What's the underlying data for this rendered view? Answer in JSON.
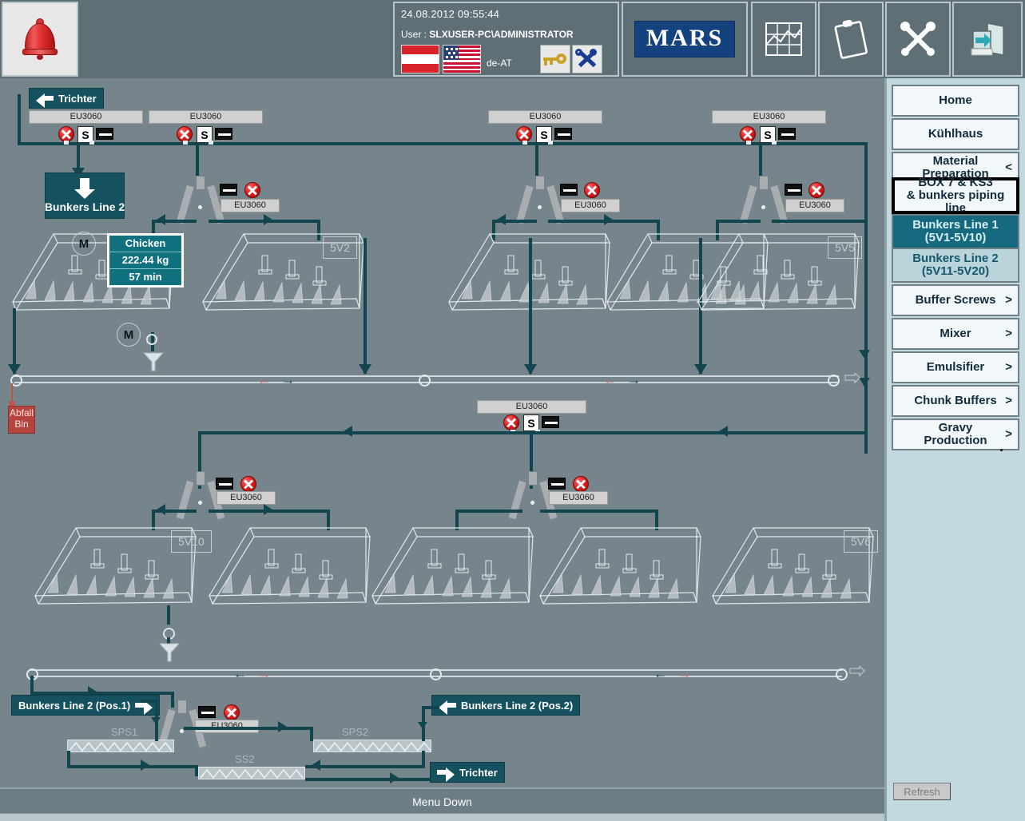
{
  "header": {
    "alarm_icon": "alarm-bell-icon",
    "datetime": "24.08.2012 09:55:44",
    "user_label": "User :",
    "user_name": "SLXUSER-PC\\ADMINISTRATOR",
    "flag_at": "austria-flag-icon",
    "flag_us": "usa-flag-icon",
    "locale": "de-AT",
    "key_gold": "gold-key-icon",
    "key_blue": "blue-crossed-keys-icon",
    "brand": "MARS",
    "trend_icon": "trend-chart-icon",
    "report_icon": "clipboard-report-icon",
    "tools_icon": "hammer-wrench-icon",
    "exit_icon": "exit-door-icon"
  },
  "sidebar": {
    "items": [
      {
        "label": "Home",
        "chev": "",
        "state": "normal"
      },
      {
        "label": "Kühlhaus",
        "chev": "",
        "state": "normal"
      },
      {
        "label": "Material\nPreparation",
        "chev": "<",
        "state": "normal"
      },
      {
        "label": "BOX 7 & KS3\n& bunkers piping line",
        "chev": "",
        "state": "outlined"
      },
      {
        "label": "Bunkers Line 1\n(5V1-5V10)",
        "chev": "",
        "state": "active"
      },
      {
        "label": "Bunkers Line 2\n(5V11-5V20)",
        "chev": "",
        "state": "selected"
      },
      {
        "label": "Buffer Screws",
        "chev": ">",
        "state": "normal"
      },
      {
        "label": "Mixer",
        "chev": ">",
        "state": "normal"
      },
      {
        "label": "Emulsifier",
        "chev": ">",
        "state": "normal"
      },
      {
        "label": "Chunk Buffers",
        "chev": ">",
        "state": "normal"
      },
      {
        "label": "Gravy\nProduction",
        "chev": ">",
        "state": "normal"
      }
    ],
    "refresh_label": "Refresh"
  },
  "page": {
    "title": "Bunkers Line 1 (5V1 - 5V10)",
    "status_text": "Menu Down"
  },
  "navplates": {
    "trichter_top": "Trichter",
    "bunkers_line2_down": "Bunkers Line 2",
    "bunkers_line2_pos1": "Bunkers Line 2 (Pos.1)",
    "bunkers_line2_pos2": "Bunkers Line 2 (Pos.2)",
    "trichter_bottom": "Trichter"
  },
  "info_box": {
    "product": "Chicken",
    "weight": "222.44 kg",
    "time": "57 min"
  },
  "waste": {
    "line1": "Abfall",
    "line2": "Bin"
  },
  "valves": [
    {
      "id": "v1",
      "tag": "EU3060",
      "has_s": true,
      "fault": true
    },
    {
      "id": "v2",
      "tag": "EU3060",
      "has_s": true,
      "fault": true
    },
    {
      "id": "v3",
      "tag": "EU3060",
      "has_s": true,
      "fault": true
    },
    {
      "id": "v4",
      "tag": "EU3060",
      "has_s": true,
      "fault": true
    },
    {
      "id": "v5",
      "tag": "EU3060",
      "has_s": true,
      "fault": true
    },
    {
      "id": "d1",
      "tag": "EU3060",
      "has_s": false,
      "fault": true
    },
    {
      "id": "d2",
      "tag": "EU3060",
      "has_s": false,
      "fault": true
    },
    {
      "id": "d3",
      "tag": "EU3060",
      "has_s": false,
      "fault": true
    },
    {
      "id": "d4",
      "tag": "EU3060",
      "has_s": false,
      "fault": true
    },
    {
      "id": "d5",
      "tag": "EU3060",
      "has_s": false,
      "fault": true
    },
    {
      "id": "d6",
      "tag": "EU3060",
      "has_s": false,
      "fault": true
    }
  ],
  "bunker_labels": {
    "b2": "5V2",
    "b5": "5V5",
    "b10": "5V10",
    "b6": "5V6"
  },
  "screw_labels": {
    "sps1": "SPS1",
    "sps2": "SPS2",
    "ss2": "SS2"
  },
  "motors": {
    "m1": "M",
    "m2": "M"
  },
  "colors": {
    "background": "#76858b",
    "pipe": "#13454f",
    "sidebar": "#c3d9e0",
    "accent_teal": "#16697f",
    "fault_red": "#e01b1b",
    "brand_blue": "#14427f",
    "waste_red": "#b5453f"
  }
}
